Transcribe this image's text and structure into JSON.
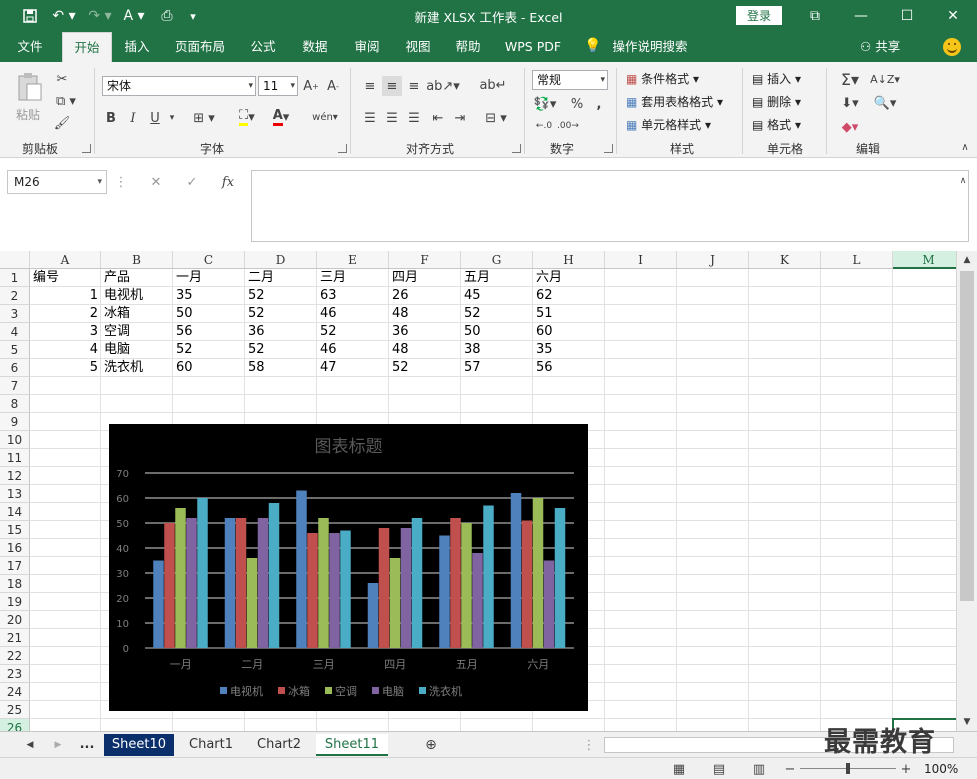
{
  "window": {
    "title": "新建 XLSX 工作表 - Excel",
    "login_label": "登录"
  },
  "tabs": [
    "文件",
    "开始",
    "插入",
    "页面布局",
    "公式",
    "数据",
    "审阅",
    "视图",
    "帮助",
    "WPS PDF"
  ],
  "active_tab": "开始",
  "tell_me": "操作说明搜索",
  "share_label": "共享",
  "ribbon": {
    "clipboard": {
      "paste_label": "粘贴",
      "group_label": "剪贴板"
    },
    "font": {
      "font_name": "宋体",
      "font_size": "11",
      "group_label": "字体",
      "bold": "B",
      "italic": "I",
      "underline": "U"
    },
    "alignment": {
      "group_label": "对齐方式"
    },
    "number": {
      "format": "常规",
      "group_label": "数字"
    },
    "styles": {
      "conditional": "条件格式",
      "table": "套用表格格式",
      "cell": "单元格样式",
      "group_label": "样式"
    },
    "cells": {
      "insert": "插入",
      "delete": "删除",
      "format": "格式",
      "group_label": "单元格"
    },
    "editing": {
      "group_label": "编辑"
    }
  },
  "formula_bar": {
    "name_box": "M26",
    "value": ""
  },
  "columns": [
    "A",
    "B",
    "C",
    "D",
    "E",
    "F",
    "G",
    "H",
    "I",
    "J",
    "K",
    "L",
    "M"
  ],
  "rows": [
    "1",
    "2",
    "3",
    "4",
    "5",
    "6",
    "7",
    "8",
    "9",
    "10",
    "11",
    "12",
    "13",
    "14",
    "15",
    "16",
    "17",
    "18",
    "19",
    "20",
    "21",
    "22",
    "23",
    "24",
    "25",
    "26"
  ],
  "sheet_rows": [
    [
      "编号",
      "产品",
      "一月",
      "二月",
      "三月",
      "四月",
      "五月",
      "六月"
    ],
    [
      "1",
      "电视机",
      "35",
      "52",
      "63",
      "26",
      "45",
      "62"
    ],
    [
      "2",
      "冰箱",
      "50",
      "52",
      "46",
      "48",
      "52",
      "51"
    ],
    [
      "3",
      "空调",
      "56",
      "36",
      "52",
      "36",
      "50",
      "60"
    ],
    [
      "4",
      "电脑",
      "52",
      "52",
      "46",
      "48",
      "38",
      "35"
    ],
    [
      "5",
      "洗衣机",
      "60",
      "58",
      "47",
      "52",
      "57",
      "56"
    ]
  ],
  "chart_data": {
    "type": "bar",
    "title": "图表标题",
    "categories": [
      "一月",
      "二月",
      "三月",
      "四月",
      "五月",
      "六月"
    ],
    "series": [
      {
        "name": "电视机",
        "values": [
          35,
          52,
          63,
          26,
          45,
          62
        ]
      },
      {
        "name": "冰箱",
        "values": [
          50,
          52,
          46,
          48,
          52,
          51
        ]
      },
      {
        "name": "空调",
        "values": [
          56,
          36,
          52,
          36,
          50,
          60
        ]
      },
      {
        "name": "电脑",
        "values": [
          52,
          52,
          46,
          48,
          38,
          35
        ]
      },
      {
        "name": "洗衣机",
        "values": [
          60,
          58,
          47,
          52,
          57,
          56
        ]
      }
    ],
    "colors": [
      "#4f81bd",
      "#c0504d",
      "#9bbb59",
      "#8064a2",
      "#4bacc6"
    ],
    "ylim": [
      0,
      70
    ],
    "yticks": [
      "0",
      "10",
      "20",
      "30",
      "40",
      "50",
      "60",
      "70"
    ],
    "grid": true,
    "legend": "bottom",
    "background": "#000000"
  },
  "sheet_tabs": [
    "Sheet10",
    "Chart1",
    "Chart2",
    "Sheet11"
  ],
  "sheet_nav_more": "...",
  "active_sheet": "Sheet11",
  "status": {
    "zoom": "100%",
    "zoom_level": 100
  },
  "watermark": "最需教育",
  "theme": {
    "accent": "#217346"
  }
}
